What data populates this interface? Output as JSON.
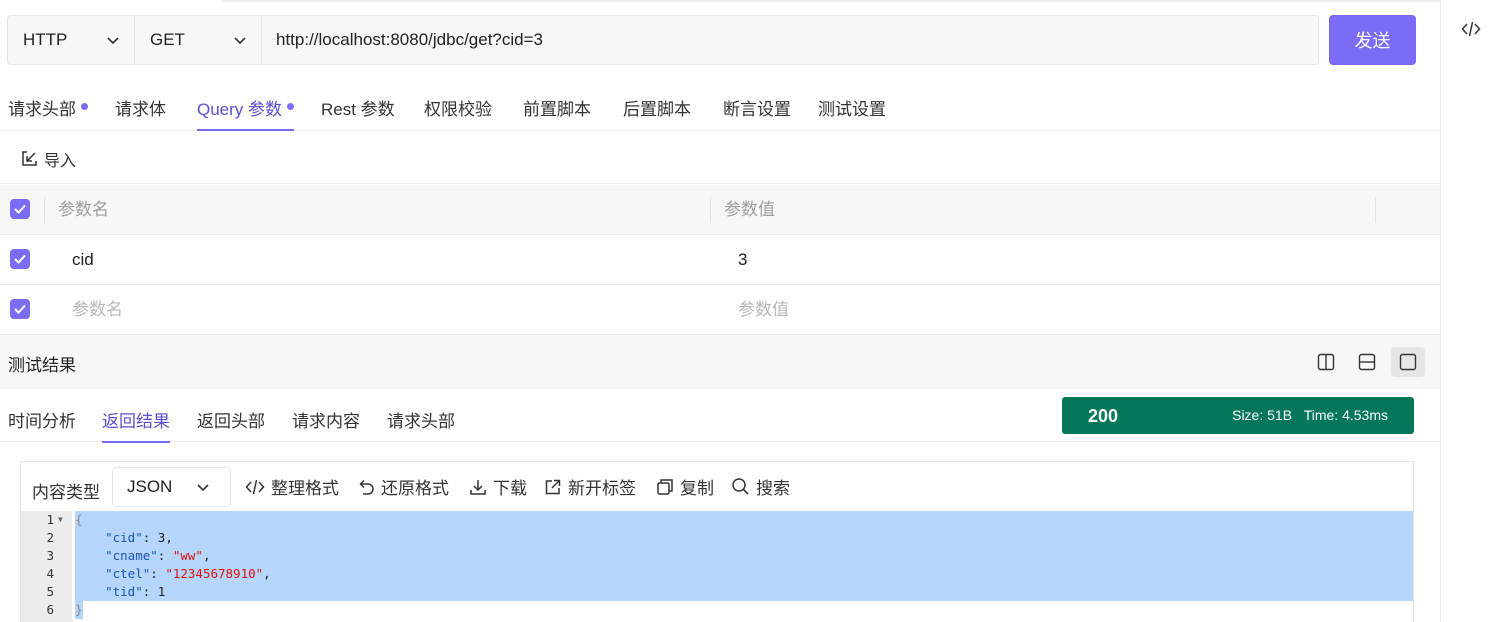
{
  "request": {
    "protocol": "HTTP",
    "method": "GET",
    "url": "http://localhost:8080/jdbc/get?cid=3",
    "send_label": "发送"
  },
  "req_tabs": [
    {
      "label": "请求头部",
      "dot": true
    },
    {
      "label": "请求体",
      "dot": false
    },
    {
      "label": "Query 参数",
      "dot": true,
      "active": true
    },
    {
      "label": "Rest 参数",
      "dot": false
    },
    {
      "label": "权限校验",
      "dot": false
    },
    {
      "label": "前置脚本",
      "dot": false
    },
    {
      "label": "后置脚本",
      "dot": false
    },
    {
      "label": "断言设置",
      "dot": false
    },
    {
      "label": "测试设置",
      "dot": false
    }
  ],
  "import_label": "导入",
  "params": {
    "header_name": "参数名",
    "header_value": "参数值",
    "rows": [
      {
        "name": "cid",
        "value": "3"
      }
    ],
    "placeholder_name": "参数名",
    "placeholder_value": "参数值"
  },
  "result": {
    "title": "测试结果"
  },
  "resp_tabs": [
    {
      "label": "时间分析"
    },
    {
      "label": "返回结果",
      "active": true
    },
    {
      "label": "返回头部"
    },
    {
      "label": "请求内容"
    },
    {
      "label": "请求头部"
    }
  ],
  "status": {
    "code": "200",
    "size": "Size: 51B",
    "time": "Time: 4.53ms",
    "color": "#04775a"
  },
  "response_toolbar": {
    "content_type_label": "内容类型",
    "content_type": "JSON",
    "format": "整理格式",
    "restore": "还原格式",
    "download": "下载",
    "new_tab": "新开标签",
    "copy": "复制",
    "search": "搜索"
  },
  "code_lines": [
    {
      "n": "1",
      "text": "{"
    },
    {
      "n": "2",
      "text": "    \"cid\": 3,"
    },
    {
      "n": "3",
      "text": "    \"cname\": \"ww\","
    },
    {
      "n": "4",
      "text": "    \"ctel\": \"12345678910\","
    },
    {
      "n": "5",
      "text": "    \"tid\": 1"
    },
    {
      "n": "6",
      "text": "}"
    }
  ],
  "accent_color": "#7b6cf6"
}
